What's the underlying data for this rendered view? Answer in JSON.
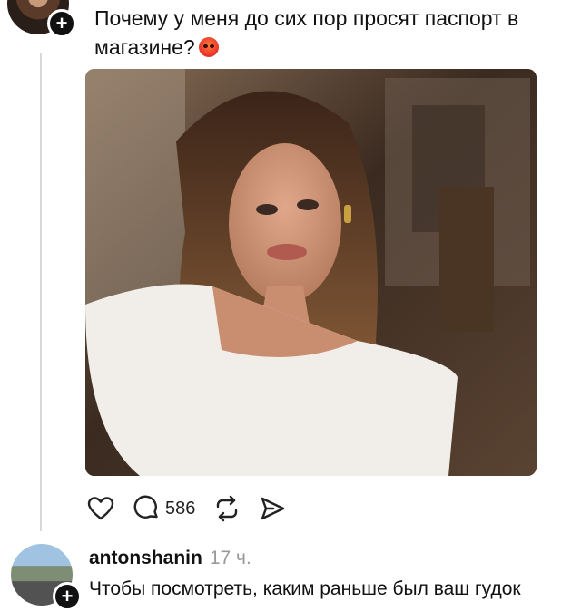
{
  "post": {
    "text": "Почему у меня до сих пор просят паспорт в магазине?",
    "emoji": "angry-face-emoji",
    "actions": {
      "like": {
        "icon": "heart-icon"
      },
      "comment": {
        "icon": "comment-bubble-icon",
        "count": "586"
      },
      "repost": {
        "icon": "repost-icon"
      },
      "share": {
        "icon": "send-icon"
      }
    }
  },
  "reply": {
    "username": "antonshanin",
    "time": "17 ч.",
    "text": "Чтобы посмотреть, каким раньше был ваш гудок"
  },
  "colors": {
    "text": "#111111",
    "muted": "#9a9a9a",
    "thread_line": "#d9d9d9"
  }
}
